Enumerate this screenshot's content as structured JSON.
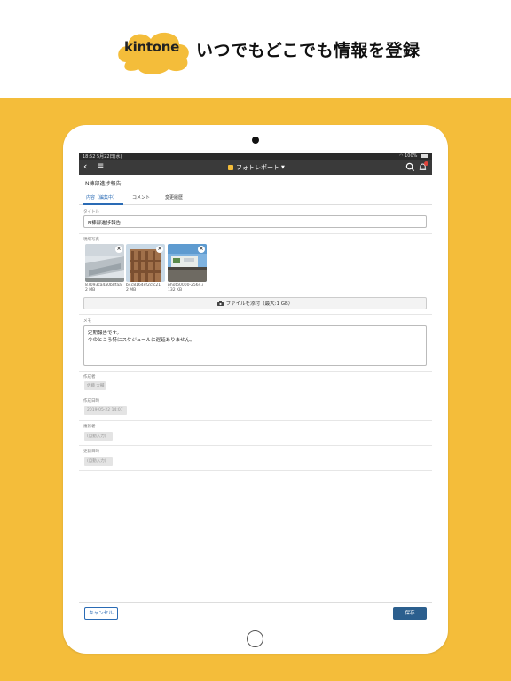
{
  "header": {
    "brand": "kintone",
    "tagline": "いつでもどこでも情報を登録"
  },
  "device": {
    "status_bar": {
      "time": "18:52  5月22日(水)",
      "battery": "100%"
    },
    "app_bar": {
      "title": "フォトレポート"
    },
    "record": {
      "title": "N棟部進捗報告",
      "tabs": [
        {
          "label": "内容（編集中）",
          "active": true
        },
        {
          "label": "コメント",
          "active": false
        },
        {
          "label": "変更履歴",
          "active": false
        }
      ],
      "fields": {
        "title_label": "タイトル",
        "title_value": "N棟部進捗報告",
        "photos_label": "現場写真",
        "photos": [
          {
            "name": "87093ca4a0b8faa",
            "size": "2 MB"
          },
          {
            "name": "b4c8164ef2cfc21",
            "size": "2 MB"
          },
          {
            "name": "photo0000-2564.j",
            "size": "132 KB"
          }
        ],
        "attach_label": "ファイルを添付（最大:1 GB）",
        "memo_label": "メモ",
        "memo_lines": [
          "定期報告です。",
          "今のところ特にスケジュールに遅延ありません。"
        ],
        "creator_label": "作成者",
        "creator_value": "佐藤 大輔",
        "created_label": "作成日時",
        "created_value": "2019-05-22 14:07",
        "updater_label": "更新者",
        "updater_value": "(自動入力)",
        "updated_label": "更新日時",
        "updated_value": "(自動入力)"
      }
    },
    "footer": {
      "cancel": "キャンセル",
      "save": "保存"
    }
  },
  "colors": {
    "background": "#f4bd3a",
    "accent_blue": "#2a6bb5",
    "save_button": "#2c5f8e",
    "app_bar": "#3a3a3a"
  }
}
